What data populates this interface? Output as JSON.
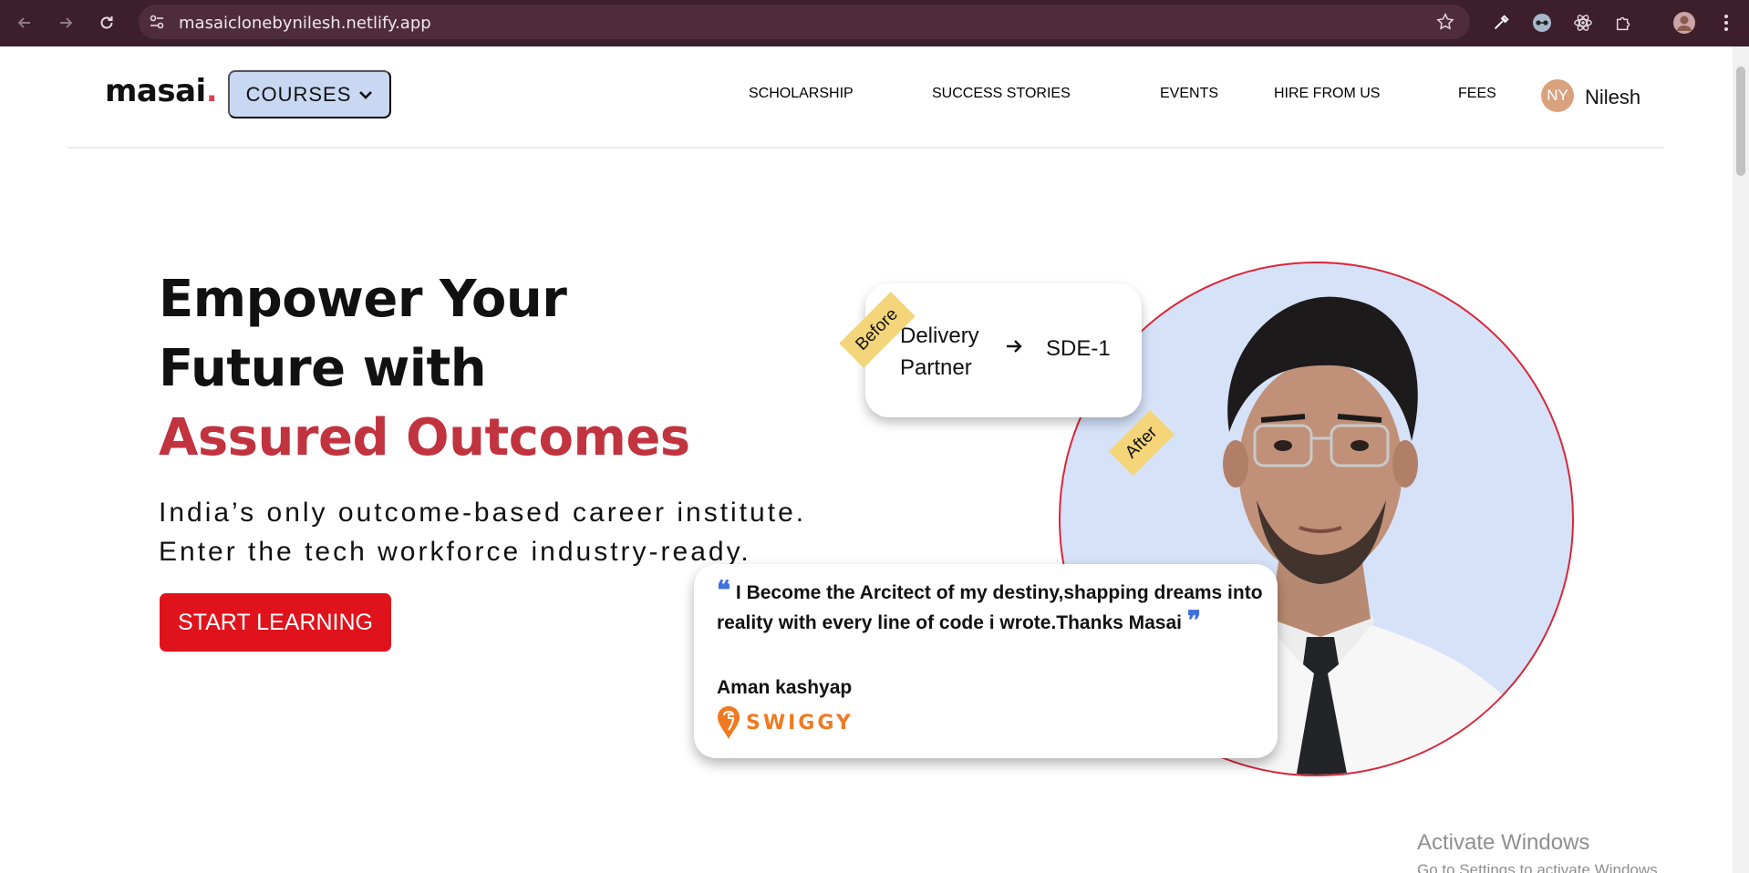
{
  "browser": {
    "url": "masaiclonebynilesh.netlify.app"
  },
  "header": {
    "logo": "masai",
    "logo_dot": ".",
    "courses_label": "COURSES",
    "nav": [
      {
        "label": "SCHOLARSHIP"
      },
      {
        "label": "SUCCESS STORIES"
      },
      {
        "label": "EVENTS"
      },
      {
        "label": "HIRE FROM US"
      },
      {
        "label": "FEES"
      }
    ],
    "user": {
      "initials": "NY",
      "name": "Nilesh"
    }
  },
  "hero": {
    "headline_line1": "Empower Your",
    "headline_line2": "Future with",
    "headline_accent": "Assured Outcomes",
    "subtext_line1": "India’s only outcome-based career institute.",
    "subtext_line2": "Enter the tech workforce industry-ready.",
    "cta_label": "START LEARNING"
  },
  "story": {
    "before_tag": "Before",
    "after_tag": "After",
    "from_line1": "Delivery",
    "from_line2": "Partner",
    "to": "SDE-1",
    "quote": "I Become the Arcitect of my destiny,shapping dreams into reality with every line of code i wrote.Thanks Masai",
    "author": "Aman kashyap",
    "company": "SWIGGY"
  },
  "watermark": {
    "title": "Activate Windows",
    "subtitle": "Go to Settings to activate Windows."
  },
  "colors": {
    "accent": "#c1333f",
    "cta": "#e0131c",
    "courses_bg": "#c8d8f2",
    "circle_bg": "#d6e2f8",
    "tag": "#f4d57a",
    "swiggy": "#f07a22"
  }
}
